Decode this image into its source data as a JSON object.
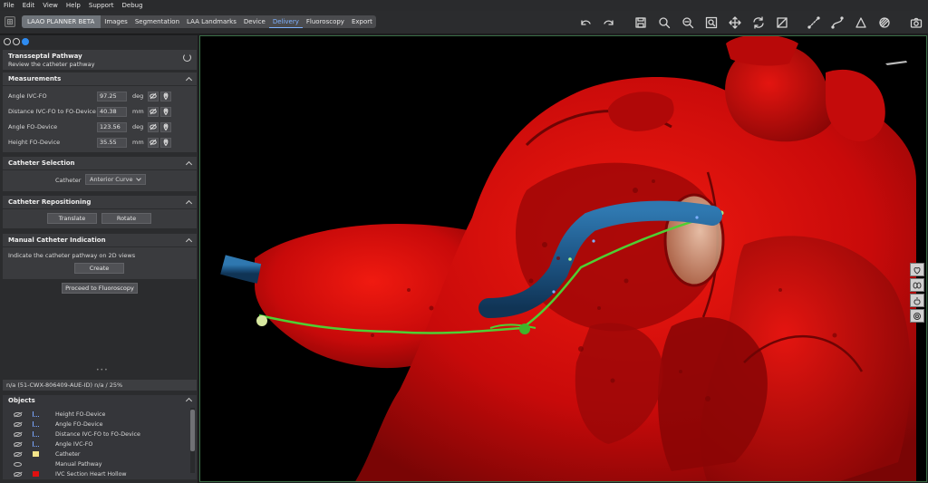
{
  "menu": [
    "File",
    "Edit",
    "View",
    "Help",
    "Support",
    "Debug"
  ],
  "tabs": {
    "brand": "LAAO PLANNER BETA",
    "items": [
      "Images",
      "Segmentation",
      "LAA Landmarks",
      "Device",
      "Delivery",
      "Fluoroscopy",
      "Export"
    ],
    "active": "Delivery"
  },
  "toolbar_icons": [
    "undo-icon",
    "redo-icon",
    "save-icon",
    "zoom-in-icon",
    "zoom-out-icon",
    "zoom-fit-icon",
    "pan-icon",
    "rotate-icon",
    "crop-icon",
    "line-measure-icon",
    "curve-measure-icon",
    "angle-measure-icon",
    "texture-icon",
    "screenshot-icon"
  ],
  "step": {
    "title": "Transseptal Pathway",
    "subtitle": "Review the catheter pathway"
  },
  "measurements": {
    "title": "Measurements",
    "rows": [
      {
        "label": "Angle IVC-FO",
        "value": "97.25",
        "unit": "deg"
      },
      {
        "label": "Distance IVC-FO to FO-Device",
        "value": "40.38",
        "unit": "mm"
      },
      {
        "label": "Angle FO-Device",
        "value": "123.56",
        "unit": "deg"
      },
      {
        "label": "Height FO-Device",
        "value": "35.55",
        "unit": "mm"
      }
    ]
  },
  "catheter_selection": {
    "title": "Catheter Selection",
    "label": "Catheter",
    "value": "Anterior Curve"
  },
  "repositioning": {
    "title": "Catheter Repositioning",
    "translate": "Translate",
    "rotate": "Rotate"
  },
  "manual": {
    "title": "Manual Catheter Indication",
    "description": "Indicate the catheter pathway on 2D views",
    "create": "Create"
  },
  "proceed": "Proceed to Fluoroscopy",
  "status": "n/a (51-CWX-806409-AUE-ID) n/a / 25%",
  "objects": {
    "title": "Objects",
    "items": [
      {
        "name": "Height FO-Device",
        "visible": false,
        "kind": "ruler"
      },
      {
        "name": "Angle FO-Device",
        "visible": false,
        "kind": "ruler"
      },
      {
        "name": "Distance IVC-FO to FO-Device",
        "visible": false,
        "kind": "ruler"
      },
      {
        "name": "Angle IVC-FO",
        "visible": false,
        "kind": "ruler"
      },
      {
        "name": "Catheter",
        "visible": false,
        "kind": "swatch",
        "color": "#f4e48a"
      },
      {
        "name": "Manual Pathway",
        "visible": true,
        "kind": "none"
      },
      {
        "name": "IVC Section Heart Hollow",
        "visible": false,
        "kind": "swatch",
        "color": "#e01010"
      }
    ]
  },
  "colors": {
    "accent": "#2e8bf0",
    "heart": "#d40c0c",
    "catheter": "#1f5a8a",
    "pathway": "#5ad23c"
  }
}
